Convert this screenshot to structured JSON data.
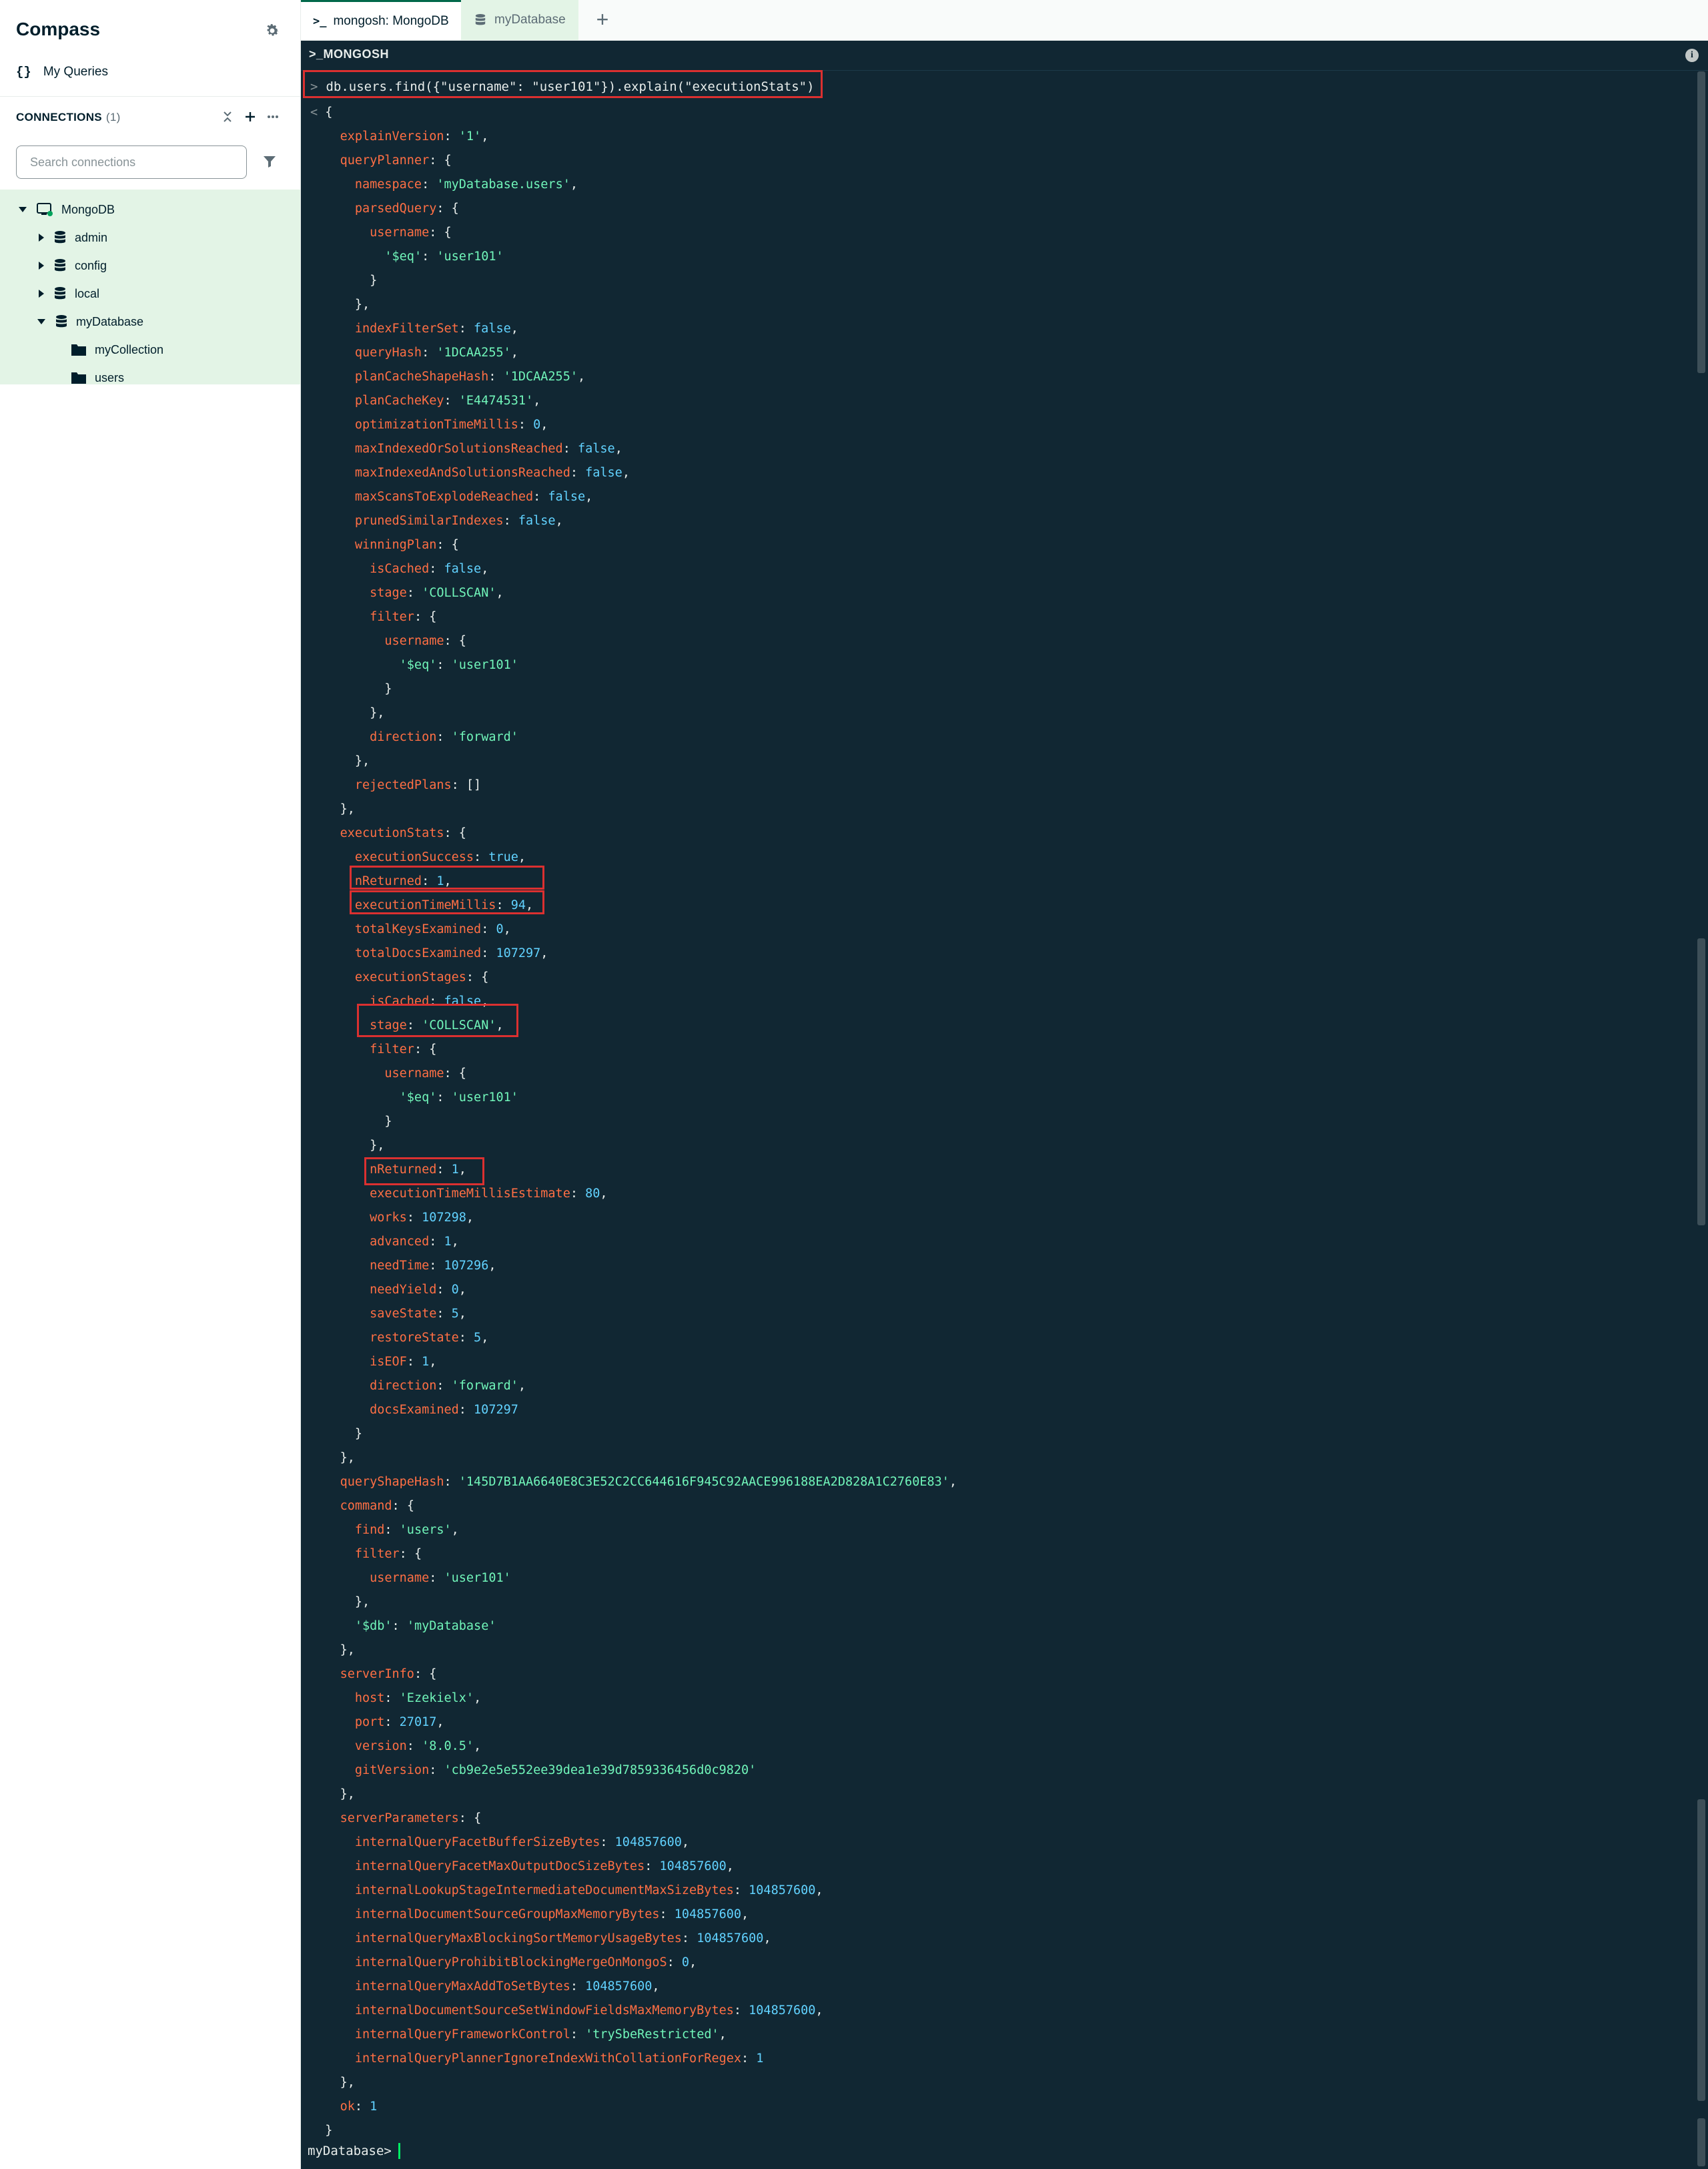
{
  "sidebar": {
    "title": "Compass",
    "my_queries_label": "My Queries",
    "my_queries_icon": "{}",
    "connections_label": "CONNECTIONS",
    "connections_count": "(1)",
    "search_placeholder": "Search connections",
    "tree": [
      {
        "label": "MongoDB",
        "kind": "connection",
        "expanded": true
      },
      {
        "label": "admin",
        "kind": "database",
        "expanded": false
      },
      {
        "label": "config",
        "kind": "database",
        "expanded": false
      },
      {
        "label": "local",
        "kind": "database",
        "expanded": false
      },
      {
        "label": "myDatabase",
        "kind": "database",
        "expanded": true
      },
      {
        "label": "myCollection",
        "kind": "collection"
      },
      {
        "label": "users",
        "kind": "collection"
      }
    ]
  },
  "tabs": [
    {
      "label": "mongosh: MongoDB",
      "icon": "terminal-icon",
      "active": true
    },
    {
      "label": "myDatabase",
      "icon": "database-icon",
      "active": false
    }
  ],
  "shell": {
    "header": ">_MONGOSH",
    "command": "db.users.find({\"username\": \"user101\"}).explain(\"executionStats\")",
    "prompt": "myDatabase",
    "output_lines": [
      {
        "indent": 0,
        "lead": "< ",
        "text": "{"
      },
      {
        "indent": 1,
        "key": "explainVersion",
        "val": "'1'",
        "type": "s",
        "end": ","
      },
      {
        "indent": 1,
        "key": "queryPlanner",
        "open": "{"
      },
      {
        "indent": 2,
        "key": "namespace",
        "val": "'myDatabase.users'",
        "type": "s",
        "end": ","
      },
      {
        "indent": 2,
        "key": "parsedQuery",
        "open": "{"
      },
      {
        "indent": 3,
        "key": "username",
        "open": "{"
      },
      {
        "indent": 4,
        "key": "'$eq'",
        "val": "'user101'",
        "type": "s",
        "end": "",
        "keyAsString": true
      },
      {
        "indent": 3,
        "text": "}"
      },
      {
        "indent": 2,
        "text": "},"
      },
      {
        "indent": 2,
        "key": "indexFilterSet",
        "val": "false",
        "type": "n",
        "end": ","
      },
      {
        "indent": 2,
        "key": "queryHash",
        "val": "'1DCAA255'",
        "type": "s",
        "end": ","
      },
      {
        "indent": 2,
        "key": "planCacheShapeHash",
        "val": "'1DCAA255'",
        "type": "s",
        "end": ","
      },
      {
        "indent": 2,
        "key": "planCacheKey",
        "val": "'E4474531'",
        "type": "s",
        "end": ","
      },
      {
        "indent": 2,
        "key": "optimizationTimeMillis",
        "val": "0",
        "type": "n",
        "end": ","
      },
      {
        "indent": 2,
        "key": "maxIndexedOrSolutionsReached",
        "val": "false",
        "type": "n",
        "end": ","
      },
      {
        "indent": 2,
        "key": "maxIndexedAndSolutionsReached",
        "val": "false",
        "type": "n",
        "end": ","
      },
      {
        "indent": 2,
        "key": "maxScansToExplodeReached",
        "val": "false",
        "type": "n",
        "end": ","
      },
      {
        "indent": 2,
        "key": "prunedSimilarIndexes",
        "val": "false",
        "type": "n",
        "end": ","
      },
      {
        "indent": 2,
        "key": "winningPlan",
        "open": "{"
      },
      {
        "indent": 3,
        "key": "isCached",
        "val": "false",
        "type": "n",
        "end": ","
      },
      {
        "indent": 3,
        "key": "stage",
        "val": "'COLLSCAN'",
        "type": "s",
        "end": ","
      },
      {
        "indent": 3,
        "key": "filter",
        "open": "{"
      },
      {
        "indent": 4,
        "key": "username",
        "open": "{"
      },
      {
        "indent": 5,
        "key": "'$eq'",
        "val": "'user101'",
        "type": "s",
        "end": "",
        "keyAsString": true
      },
      {
        "indent": 4,
        "text": "}"
      },
      {
        "indent": 3,
        "text": "},"
      },
      {
        "indent": 3,
        "key": "direction",
        "val": "'forward'",
        "type": "s",
        "end": ""
      },
      {
        "indent": 2,
        "text": "},"
      },
      {
        "indent": 2,
        "key": "rejectedPlans",
        "val": "[]",
        "type": "p",
        "end": ""
      },
      {
        "indent": 1,
        "text": "},"
      },
      {
        "indent": 1,
        "key": "executionStats",
        "open": "{"
      },
      {
        "indent": 2,
        "key": "executionSuccess",
        "val": "true",
        "type": "n",
        "end": ","
      },
      {
        "indent": 2,
        "key": "nReturned",
        "val": "1",
        "type": "n",
        "end": ","
      },
      {
        "indent": 2,
        "key": "executionTimeMillis",
        "val": "94",
        "type": "n",
        "end": ","
      },
      {
        "indent": 2,
        "key": "totalKeysExamined",
        "val": "0",
        "type": "n",
        "end": ","
      },
      {
        "indent": 2,
        "key": "totalDocsExamined",
        "val": "107297",
        "type": "n",
        "end": ","
      },
      {
        "indent": 2,
        "key": "executionStages",
        "open": "{"
      },
      {
        "indent": 3,
        "key": "isCached",
        "val": "false",
        "type": "n",
        "end": ","
      },
      {
        "indent": 3,
        "key": "stage",
        "val": "'COLLSCAN'",
        "type": "s",
        "end": ","
      },
      {
        "indent": 3,
        "key": "filter",
        "open": "{"
      },
      {
        "indent": 4,
        "key": "username",
        "open": "{"
      },
      {
        "indent": 5,
        "key": "'$eq'",
        "val": "'user101'",
        "type": "s",
        "end": "",
        "keyAsString": true
      },
      {
        "indent": 4,
        "text": "}"
      },
      {
        "indent": 3,
        "text": "},"
      },
      {
        "indent": 3,
        "key": "nReturned",
        "val": "1",
        "type": "n",
        "end": ","
      },
      {
        "indent": 3,
        "key": "executionTimeMillisEstimate",
        "val": "80",
        "type": "n",
        "end": ","
      },
      {
        "indent": 3,
        "key": "works",
        "val": "107298",
        "type": "n",
        "end": ","
      },
      {
        "indent": 3,
        "key": "advanced",
        "val": "1",
        "type": "n",
        "end": ","
      },
      {
        "indent": 3,
        "key": "needTime",
        "val": "107296",
        "type": "n",
        "end": ","
      },
      {
        "indent": 3,
        "key": "needYield",
        "val": "0",
        "type": "n",
        "end": ","
      },
      {
        "indent": 3,
        "key": "saveState",
        "val": "5",
        "type": "n",
        "end": ","
      },
      {
        "indent": 3,
        "key": "restoreState",
        "val": "5",
        "type": "n",
        "end": ","
      },
      {
        "indent": 3,
        "key": "isEOF",
        "val": "1",
        "type": "n",
        "end": ","
      },
      {
        "indent": 3,
        "key": "direction",
        "val": "'forward'",
        "type": "s",
        "end": ","
      },
      {
        "indent": 3,
        "key": "docsExamined",
        "val": "107297",
        "type": "n",
        "end": ""
      },
      {
        "indent": 2,
        "text": "}"
      },
      {
        "indent": 1,
        "text": "},"
      },
      {
        "indent": 1,
        "key": "queryShapeHash",
        "val": "'145D7B1AA6640E8C3E52C2CC644616F945C92AACE996188EA2D828A1C2760E83'",
        "type": "s",
        "end": ","
      },
      {
        "indent": 1,
        "key": "command",
        "open": "{"
      },
      {
        "indent": 2,
        "key": "find",
        "val": "'users'",
        "type": "s",
        "end": ","
      },
      {
        "indent": 2,
        "key": "filter",
        "open": "{"
      },
      {
        "indent": 3,
        "key": "username",
        "val": "'user101'",
        "type": "s",
        "end": ""
      },
      {
        "indent": 2,
        "text": "},"
      },
      {
        "indent": 2,
        "key": "'$db'",
        "val": "'myDatabase'",
        "type": "s",
        "end": "",
        "keyAsString": true
      },
      {
        "indent": 1,
        "text": "},"
      },
      {
        "indent": 1,
        "key": "serverInfo",
        "open": "{"
      },
      {
        "indent": 2,
        "key": "host",
        "val": "'Ezekielx'",
        "type": "s",
        "end": ","
      },
      {
        "indent": 2,
        "key": "port",
        "val": "27017",
        "type": "n",
        "end": ","
      },
      {
        "indent": 2,
        "key": "version",
        "val": "'8.0.5'",
        "type": "s",
        "end": ","
      },
      {
        "indent": 2,
        "key": "gitVersion",
        "val": "'cb9e2e5e552ee39dea1e39d7859336456d0c9820'",
        "type": "s",
        "end": ""
      },
      {
        "indent": 1,
        "text": "},"
      },
      {
        "indent": 1,
        "key": "serverParameters",
        "open": "{"
      },
      {
        "indent": 2,
        "key": "internalQueryFacetBufferSizeBytes",
        "val": "104857600",
        "type": "n",
        "end": ","
      },
      {
        "indent": 2,
        "key": "internalQueryFacetMaxOutputDocSizeBytes",
        "val": "104857600",
        "type": "n",
        "end": ","
      },
      {
        "indent": 2,
        "key": "internalLookupStageIntermediateDocumentMaxSizeBytes",
        "val": "104857600",
        "type": "n",
        "end": ","
      },
      {
        "indent": 2,
        "key": "internalDocumentSourceGroupMaxMemoryBytes",
        "val": "104857600",
        "type": "n",
        "end": ","
      },
      {
        "indent": 2,
        "key": "internalQueryMaxBlockingSortMemoryUsageBytes",
        "val": "104857600",
        "type": "n",
        "end": ","
      },
      {
        "indent": 2,
        "key": "internalQueryProhibitBlockingMergeOnMongoS",
        "val": "0",
        "type": "n",
        "end": ","
      },
      {
        "indent": 2,
        "key": "internalQueryMaxAddToSetBytes",
        "val": "104857600",
        "type": "n",
        "end": ","
      },
      {
        "indent": 2,
        "key": "internalDocumentSourceSetWindowFieldsMaxMemoryBytes",
        "val": "104857600",
        "type": "n",
        "end": ","
      },
      {
        "indent": 2,
        "key": "internalQueryFrameworkControl",
        "val": "'trySbeRestricted'",
        "type": "s",
        "end": ","
      },
      {
        "indent": 2,
        "key": "internalQueryPlannerIgnoreIndexWithCollationForRegex",
        "val": "1",
        "type": "n",
        "end": ""
      },
      {
        "indent": 1,
        "text": "},"
      },
      {
        "indent": 1,
        "key": "ok",
        "val": "1",
        "type": "n",
        "end": ""
      },
      {
        "indent": 0,
        "text": "}"
      }
    ]
  },
  "colors": {
    "accent_green": "#00684a",
    "sidebar_highlight": "#e3f4e6",
    "shell_bg": "#112733",
    "key_color": "#ff6f44",
    "string_color": "#71f6ba",
    "number_color": "#61d2ff",
    "highlight_box": "#db3030"
  }
}
